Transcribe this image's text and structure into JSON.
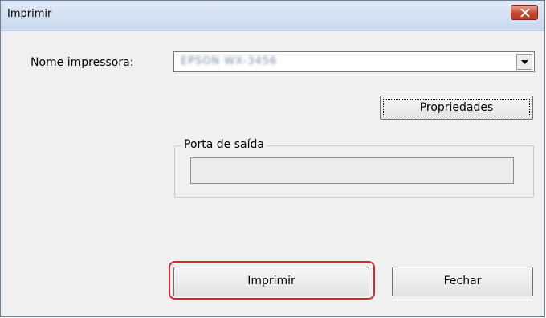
{
  "window": {
    "title": "Imprimir"
  },
  "form": {
    "printer_label": "Nome impressora:",
    "printer_value": "EPSON WX-3456",
    "properties_label": "Propriedades",
    "port_group_label": "Porta de saída",
    "port_value": ""
  },
  "actions": {
    "print_label": "Imprimir",
    "close_label": "Fechar"
  },
  "colors": {
    "highlight": "#d9262b",
    "close_button": "#c7452f"
  },
  "icons": {
    "close": "close-icon",
    "dropdown": "chevron-down-icon"
  }
}
